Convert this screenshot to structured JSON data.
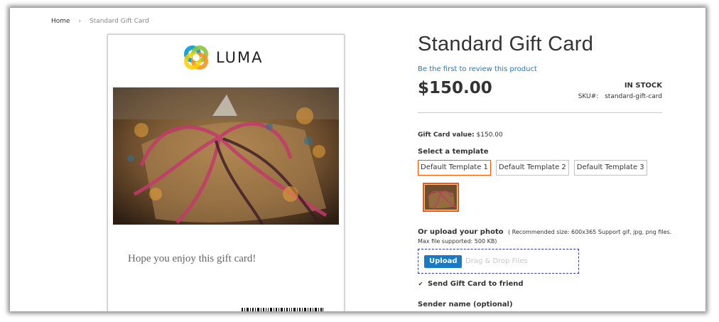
{
  "breadcrumb": {
    "home": "Home",
    "separator": "›",
    "current": "Standard Gift Card"
  },
  "card": {
    "logo_text": "LUMA",
    "message": "Hope you enjoy this gift card!"
  },
  "product": {
    "title": "Standard Gift Card",
    "review_link": "Be the first to review this product",
    "price": "$150.00",
    "stock": "IN STOCK",
    "sku_label": "SKU#:",
    "sku_value": "standard-gift-card"
  },
  "gift_card_value": {
    "label": "Gift Card value:",
    "value": "$150.00"
  },
  "template": {
    "label": "Select a template",
    "options": [
      "Default Template 1",
      "Default Template 2",
      "Default Template 3"
    ],
    "selected_index": 0
  },
  "upload": {
    "label": "Or upload your photo",
    "hint": "( Recommended size: 600x365 Support gif, jpg, png files. Max file supported: 500 KB)",
    "button": "Upload",
    "drop_text": "Drag & Drop Files"
  },
  "send_to_friend": {
    "label": "Send Gift Card to friend",
    "checked": true,
    "check_glyph": "✔"
  },
  "sender_name": {
    "label": "Sender name (optional)"
  },
  "colors": {
    "accent": "#ff5501",
    "link": "#1979c3",
    "upload_button": "#1979c3"
  },
  "icons": {
    "logo": "luma-logo-icon",
    "barcode": "barcode-icon",
    "gift_photo": "gift-photo-image"
  }
}
